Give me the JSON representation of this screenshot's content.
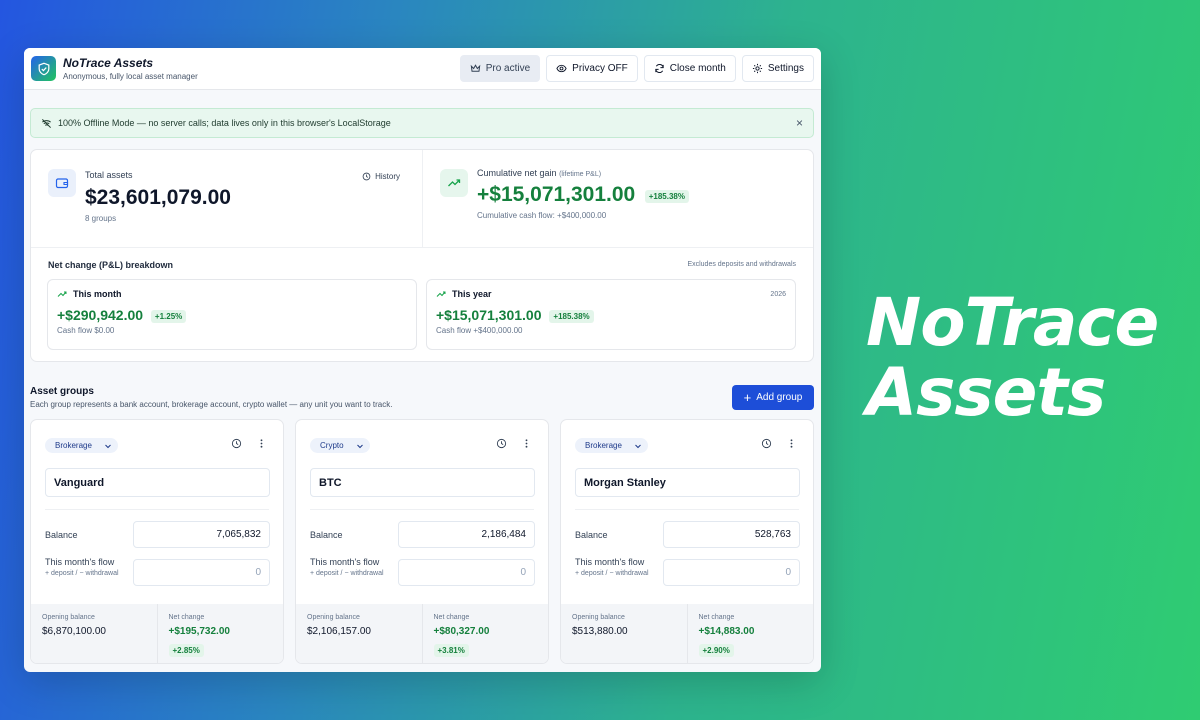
{
  "hero": {
    "line1": "NoTrace",
    "line2": "Assets"
  },
  "app": {
    "name": "NoTrace Assets",
    "tagline": "Anonymous, fully local asset manager"
  },
  "header": {
    "pro_label": "Pro active",
    "privacy_label": "Privacy OFF",
    "close_month_label": "Close month",
    "settings_label": "Settings"
  },
  "banner": {
    "text": "100% Offline Mode — no server calls; data lives only in this browser's LocalStorage",
    "close": "×"
  },
  "summary": {
    "total_label": "Total assets",
    "total_value": "$23,601,079.00",
    "groups_count": "8 groups",
    "history_label": "History",
    "gain_label": "Cumulative net gain",
    "gain_note": "(lifetime P&L)",
    "gain_value": "+$15,071,301.00",
    "gain_pct": "+185.38%",
    "cash_flow": "Cumulative cash flow: +$400,000.00"
  },
  "breakdown": {
    "title": "Net change (P&L) breakdown",
    "note": "Excludes deposits and withdrawals",
    "month": {
      "label": "This month",
      "value": "+$290,942.00",
      "pct": "+1.25%",
      "flow": "Cash flow $0.00"
    },
    "year": {
      "label": "This year",
      "year": "2026",
      "value": "+$15,071,301.00",
      "pct": "+185.38%",
      "flow": "Cash flow +$400,000.00"
    }
  },
  "groups": {
    "title": "Asset groups",
    "subtitle": "Each group represents a bank account, brokerage account, crypto wallet — any unit you want to track.",
    "add_label": "Add group",
    "balance_label": "Balance",
    "flow_label": "This month's flow",
    "flow_hint": "+ deposit / − withdrawal",
    "opening_label": "Opening balance",
    "net_label": "Net change",
    "items": [
      {
        "type": "Brokerage",
        "name": "Vanguard",
        "balance": "7,065,832",
        "flow_placeholder": "0",
        "opening": "$6,870,100.00",
        "net": "+$195,732.00",
        "pct": "+2.85%"
      },
      {
        "type": "Crypto",
        "name": "BTC",
        "balance": "2,186,484",
        "flow_placeholder": "0",
        "opening": "$2,106,157.00",
        "net": "+$80,327.00",
        "pct": "+3.81%"
      },
      {
        "type": "Brokerage",
        "name": "Morgan Stanley",
        "balance": "528,763",
        "flow_placeholder": "0",
        "opening": "$513,880.00",
        "net": "+$14,883.00",
        "pct": "+2.90%"
      }
    ]
  },
  "colors": {
    "accent": "#1d4ed8",
    "positive": "#15803d",
    "banner_bg": "#e8f7ef"
  }
}
